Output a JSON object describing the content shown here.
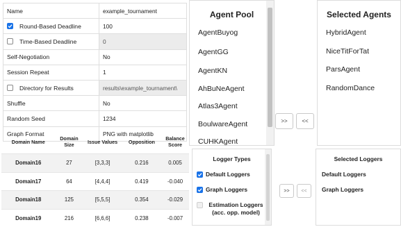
{
  "settings": {
    "rows": [
      {
        "label": "Name",
        "value": "example_tournament",
        "checkbox": null,
        "disabled": false
      },
      {
        "label": "Round-Based Deadline",
        "value": "100",
        "checkbox": true,
        "disabled": false
      },
      {
        "label": "Time-Based Deadline",
        "value": "0",
        "checkbox": false,
        "disabled": true
      },
      {
        "label": "Self-Negotiation",
        "value": "No",
        "checkbox": null,
        "disabled": false
      },
      {
        "label": "Session Repeat",
        "value": "1",
        "checkbox": null,
        "disabled": false
      },
      {
        "label": "Directory for Results",
        "value": "results\\example_tournament\\",
        "checkbox": false,
        "disabled": true
      },
      {
        "label": "Shuffle",
        "value": "No",
        "checkbox": null,
        "disabled": false
      },
      {
        "label": "Random Seed",
        "value": "1234",
        "checkbox": null,
        "disabled": false
      },
      {
        "label": "Graph Format",
        "value": "PNG with matplotlib",
        "checkbox": null,
        "disabled": false
      }
    ]
  },
  "domains": {
    "headers": [
      "Domain Name",
      "Domain Size",
      "Issue Values",
      "Opposition",
      "Balance Score"
    ],
    "rows": [
      [
        "Domain16",
        "27",
        "[3,3,3]",
        "0.216",
        "0.005"
      ],
      [
        "Domain17",
        "64",
        "[4,4,4]",
        "0.419",
        "-0.040"
      ],
      [
        "Domain18",
        "125",
        "[5,5,5]",
        "0.354",
        "-0.029"
      ],
      [
        "Domain19",
        "216",
        "[6,6,6]",
        "0.238",
        "-0.007"
      ]
    ]
  },
  "agent_pool": {
    "title": "Agent Pool",
    "items": [
      "AgentBuyog",
      "AgentGG",
      "AgentKN",
      "AhBuNeAgent",
      "Atlas3Agent",
      "BoulwareAgent",
      "CUHKAgent"
    ]
  },
  "selected_agents": {
    "title": "Selected Agents",
    "items": [
      "HybridAgent",
      "NiceTitForTat",
      "ParsAgent",
      "RandomDance"
    ]
  },
  "agent_buttons": {
    "add": ">>",
    "remove": "<<"
  },
  "logger_types": {
    "title": "Logger Types",
    "items": [
      {
        "label": "Default Loggers",
        "checked": true
      },
      {
        "label": "Graph Loggers",
        "checked": true
      },
      {
        "label": "Estimation Loggers (acc. opp. model)",
        "checked": false
      }
    ]
  },
  "selected_loggers": {
    "title": "Selected Loggers",
    "items": [
      "Default Loggers",
      "Graph Loggers"
    ]
  },
  "logger_buttons": {
    "add": ">>",
    "remove": "<<"
  },
  "colors": {
    "accent": "#1a73e8",
    "disabled_bg": "#ececec",
    "row_alt": "#f2f2f2",
    "border": "#dcdcdc"
  }
}
